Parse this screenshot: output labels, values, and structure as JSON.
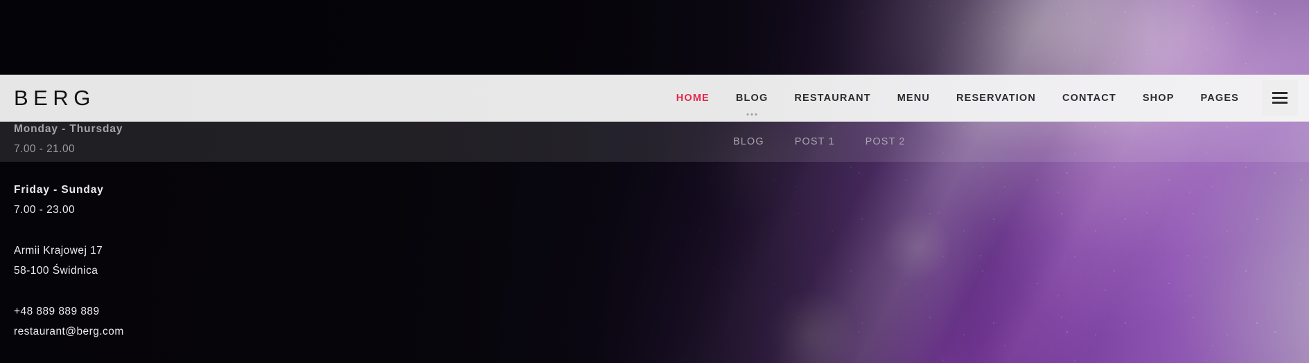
{
  "site": {
    "logo": "BERG",
    "accent_color": "#e0294b",
    "navbar_bg": "#e8e8e8"
  },
  "nav": {
    "items": [
      {
        "label": "HOME",
        "active": true,
        "has_submenu": false
      },
      {
        "label": "BLOG",
        "active": false,
        "has_submenu": true
      },
      {
        "label": "RESTAURANT",
        "active": false,
        "has_submenu": false
      },
      {
        "label": "MENU",
        "active": false,
        "has_submenu": false
      },
      {
        "label": "RESERVATION",
        "active": false,
        "has_submenu": false
      },
      {
        "label": "CONTACT",
        "active": false,
        "has_submenu": false
      },
      {
        "label": "SHOP",
        "active": false,
        "has_submenu": false
      },
      {
        "label": "PAGES",
        "active": false,
        "has_submenu": false
      }
    ],
    "menu_toggle_icon": "hamburger-icon"
  },
  "submenu": {
    "parent": "BLOG",
    "items": [
      {
        "label": "BLOG"
      },
      {
        "label": "POST 1"
      },
      {
        "label": "POST 2"
      }
    ]
  },
  "info": {
    "hours": [
      {
        "days": "Monday - Thursday",
        "time": "7.00 - 21.00"
      },
      {
        "days": "Friday - Sunday",
        "time": "7.00 - 23.00"
      }
    ],
    "address": {
      "street": "Armii Krajowej 17",
      "city": "58-100 Świdnica"
    },
    "contact": {
      "phone": "+48 889 889 889",
      "email": "restaurant@berg.com"
    }
  }
}
